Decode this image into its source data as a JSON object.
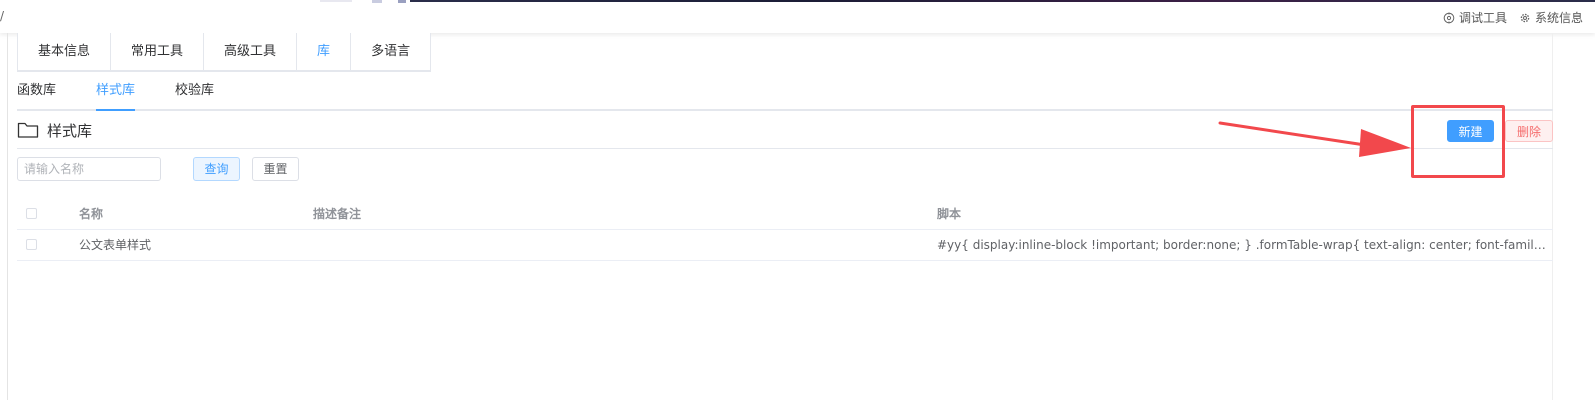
{
  "header": {
    "slash": "/",
    "debug_tool": "调试工具",
    "system_info": "系统信息"
  },
  "main_tabs": [
    {
      "label": "基本信息",
      "active": false
    },
    {
      "label": "常用工具",
      "active": false
    },
    {
      "label": "高级工具",
      "active": false
    },
    {
      "label": "库",
      "active": true
    },
    {
      "label": "多语言",
      "active": false
    }
  ],
  "sub_tabs": [
    {
      "label": "函数库",
      "active": false
    },
    {
      "label": "样式库",
      "active": true
    },
    {
      "label": "校验库",
      "active": false
    }
  ],
  "section": {
    "title": "样式库",
    "new_label": "新建",
    "delete_label": "删除"
  },
  "search": {
    "placeholder": "请输入名称",
    "query_label": "查询",
    "reset_label": "重置"
  },
  "table": {
    "columns": [
      "名称",
      "描述备注",
      "脚本"
    ],
    "rows": [
      {
        "name": "公文表单样式",
        "description": "",
        "script": "#yy{ display:inline-block !important; border:none; } .formTable-wrap{ text-align: center; font-family: 仿宋体..."
      }
    ]
  },
  "colors": {
    "primary": "#409eff",
    "danger": "#f56c6c",
    "annotation": "#f2484c"
  }
}
